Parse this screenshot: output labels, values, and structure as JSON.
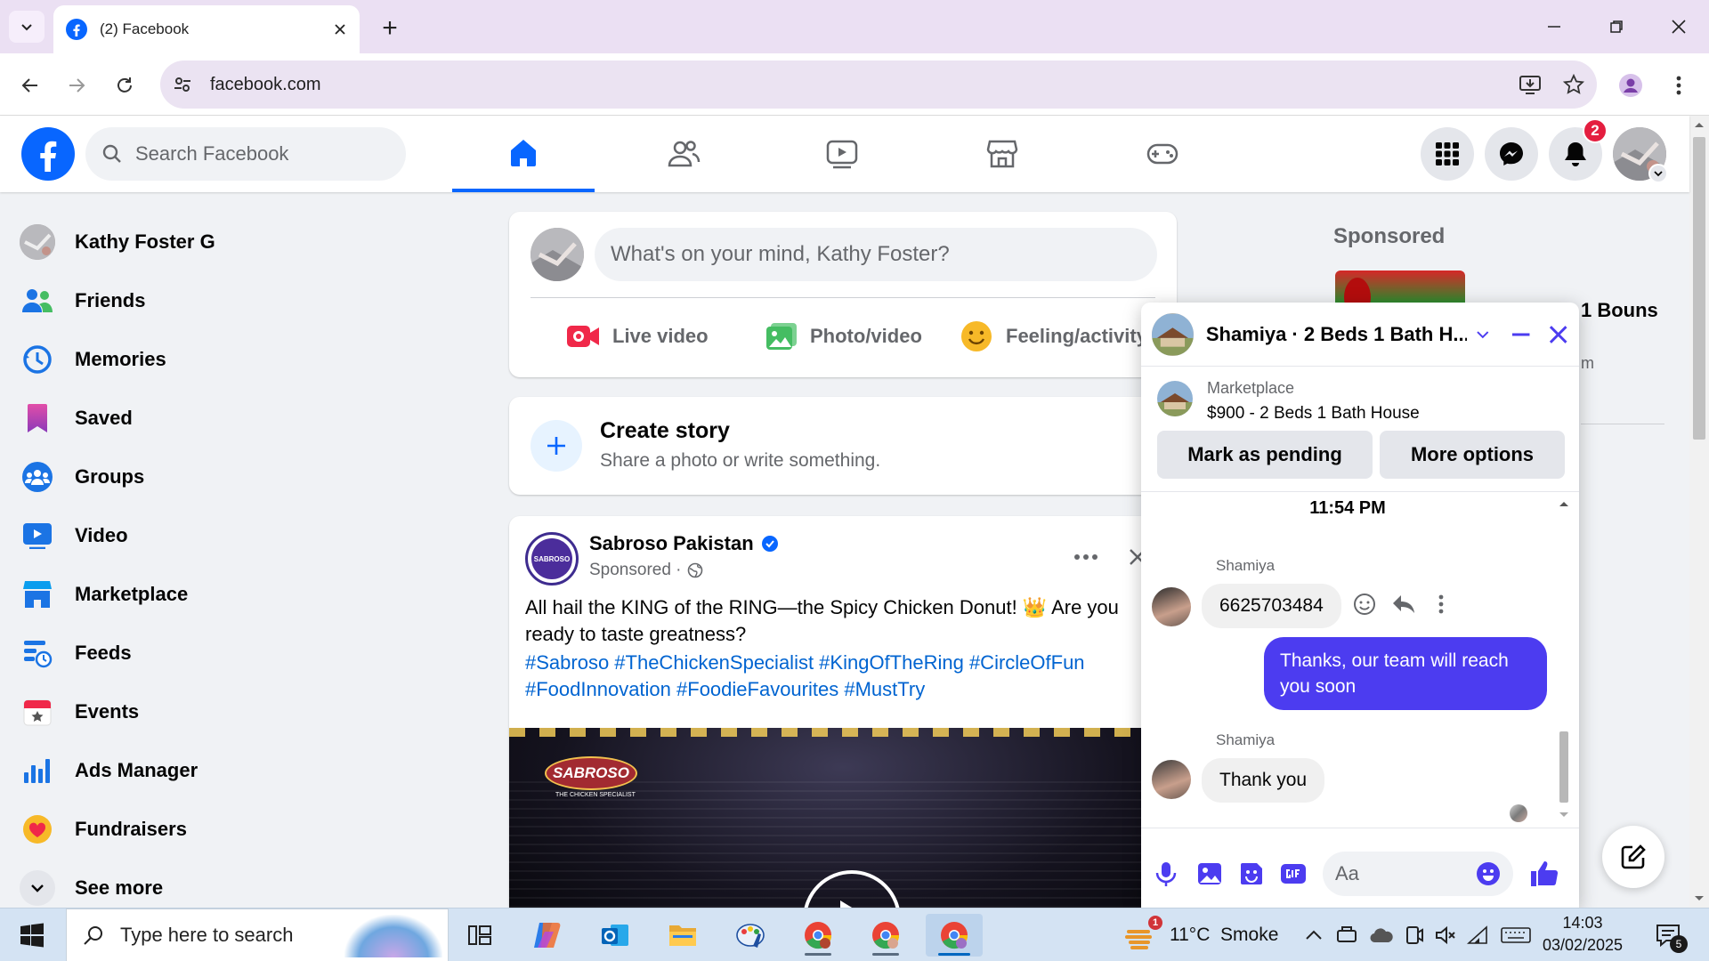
{
  "browser": {
    "tab_title": "(2) Facebook",
    "url": "facebook.com",
    "new_tab_symbol": "+"
  },
  "fb_header": {
    "search_placeholder": "Search Facebook",
    "notification_count": "2"
  },
  "sidebar": {
    "items": [
      {
        "label": "Kathy Foster G",
        "icon": "profile-avatar"
      },
      {
        "label": "Friends",
        "icon": "friends-icon"
      },
      {
        "label": "Memories",
        "icon": "memories-clock-icon"
      },
      {
        "label": "Saved",
        "icon": "saved-bookmark-icon"
      },
      {
        "label": "Groups",
        "icon": "groups-icon"
      },
      {
        "label": "Video",
        "icon": "video-icon"
      },
      {
        "label": "Marketplace",
        "icon": "marketplace-shop-icon"
      },
      {
        "label": "Feeds",
        "icon": "feeds-icon"
      },
      {
        "label": "Events",
        "icon": "events-calendar-icon"
      },
      {
        "label": "Ads Manager",
        "icon": "ads-manager-chart-icon"
      },
      {
        "label": "Fundraisers",
        "icon": "fundraisers-heart-icon"
      },
      {
        "label": "See more",
        "icon": "chevron-down-icon"
      }
    ]
  },
  "composer": {
    "placeholder": "What's on your mind, Kathy Foster?",
    "actions": [
      "Live video",
      "Photo/video",
      "Feeling/activity"
    ]
  },
  "story": {
    "title": "Create story",
    "subtitle": "Share a photo or write something."
  },
  "post": {
    "page_name": "Sabroso Pakistan",
    "meta": "Sponsored ·",
    "avatar_text": "SABROSO",
    "text": "All hail the KING of the RING—the Spicy Chicken Donut! 👑 Are you ready to taste greatness?",
    "tags_line1": "#Sabroso #TheChickenSpecialist #KingOfTheRing #CircleOfFun",
    "tags_line2": "#FoodInnovation #FoodieFavourites #MustTry",
    "image_brand": "SABROSO",
    "image_brand_sub": "THE CHICKEN SPECIALIST"
  },
  "right_rail": {
    "sponsored_title": "Sponsored",
    "ad_text": "1 Bouns",
    "ad_sub": "m"
  },
  "chat": {
    "title": "Shamiya · 2 Beds 1 Bath H...",
    "listing_label": "Marketplace",
    "listing_title": "$900 - 2 Beds 1 Bath House",
    "mark_pending": "Mark as pending",
    "more_options": "More options",
    "timestamp": "11:54 PM",
    "messages": [
      {
        "sender": "Shamiya",
        "text": "6625703484",
        "direction": "in"
      },
      {
        "sender": "",
        "text": "Thanks, our team will reach you soon",
        "direction": "out"
      },
      {
        "sender": "Shamiya",
        "text": "Thank you",
        "direction": "in"
      }
    ],
    "input_placeholder": "Aa"
  },
  "taskbar": {
    "search_placeholder": "Type here to search",
    "weather": "11°C  Smoke",
    "weather_badge": "1",
    "time": "14:03",
    "date": "03/02/2025",
    "notification_count": "5"
  },
  "colors": {
    "fb_blue": "#0866ff",
    "messenger_purple": "#4c3cf0",
    "badge_red": "#e41e3f",
    "browser_frame": "#ebe0f3"
  }
}
